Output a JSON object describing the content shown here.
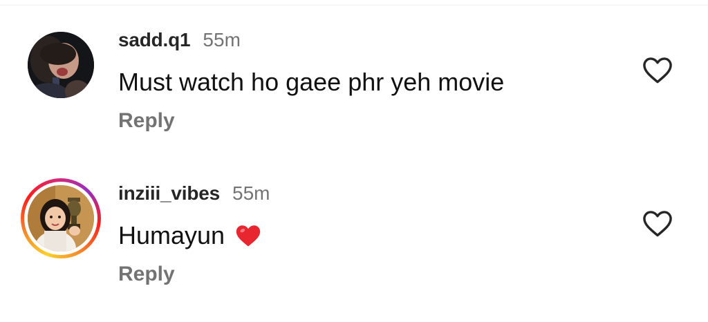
{
  "comments": [
    {
      "username": "sadd.q1",
      "time": "55m",
      "text": "Must watch ho gaee phr yeh movie",
      "reply_label": "Reply",
      "has_story_ring": false,
      "like_icon": "heart-outline-icon"
    },
    {
      "username": "inziii_vibes",
      "time": "55m",
      "text": "Humayun",
      "emoji": "heart-emoji",
      "reply_label": "Reply",
      "has_story_ring": true,
      "like_icon": "heart-outline-icon"
    }
  ],
  "colors": {
    "username": "#262626",
    "timestamp": "#737373",
    "reply": "#737373",
    "emoji_heart": "#e8262f",
    "story_ring": [
      "#fdd02a",
      "#f58529",
      "#d62976",
      "#962fbf"
    ]
  }
}
